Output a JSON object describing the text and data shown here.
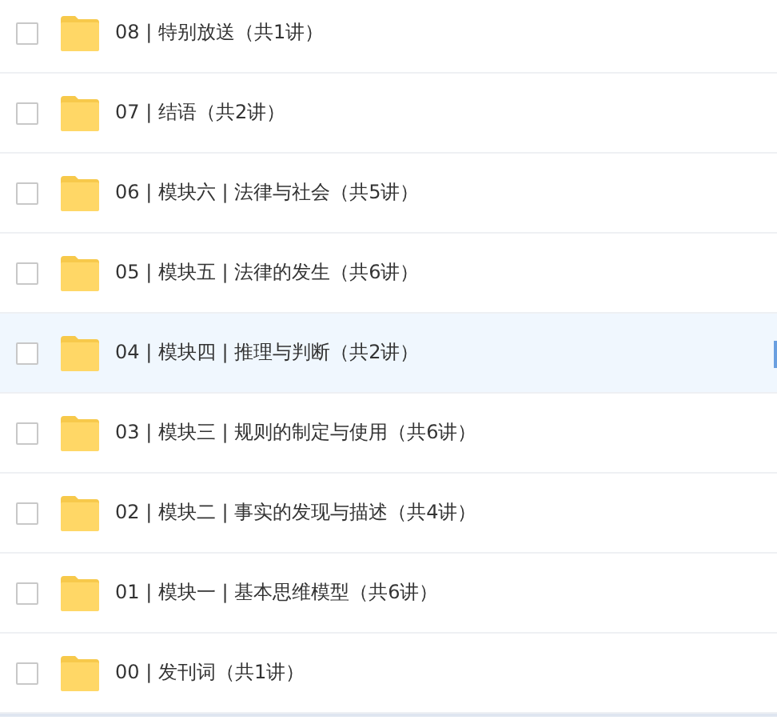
{
  "folders": [
    {
      "name": "08 | 特别放送（共1讲）",
      "checked": false,
      "selected": false
    },
    {
      "name": "07 | 结语（共2讲）",
      "checked": false,
      "selected": false
    },
    {
      "name": "06 | 模块六 | 法律与社会（共5讲）",
      "checked": false,
      "selected": false
    },
    {
      "name": "05 | 模块五 | 法律的发生（共6讲）",
      "checked": false,
      "selected": false
    },
    {
      "name": "04 | 模块四 | 推理与判断（共2讲）",
      "checked": false,
      "selected": true
    },
    {
      "name": "03 | 模块三 | 规则的制定与使用（共6讲）",
      "checked": false,
      "selected": false
    },
    {
      "name": "02 | 模块二 | 事实的发现与描述（共4讲）",
      "checked": false,
      "selected": false
    },
    {
      "name": "01 | 模块一 | 基本思维模型（共6讲）",
      "checked": false,
      "selected": false
    },
    {
      "name": "00 | 发刊词（共1讲）",
      "checked": false,
      "selected": false
    }
  ]
}
